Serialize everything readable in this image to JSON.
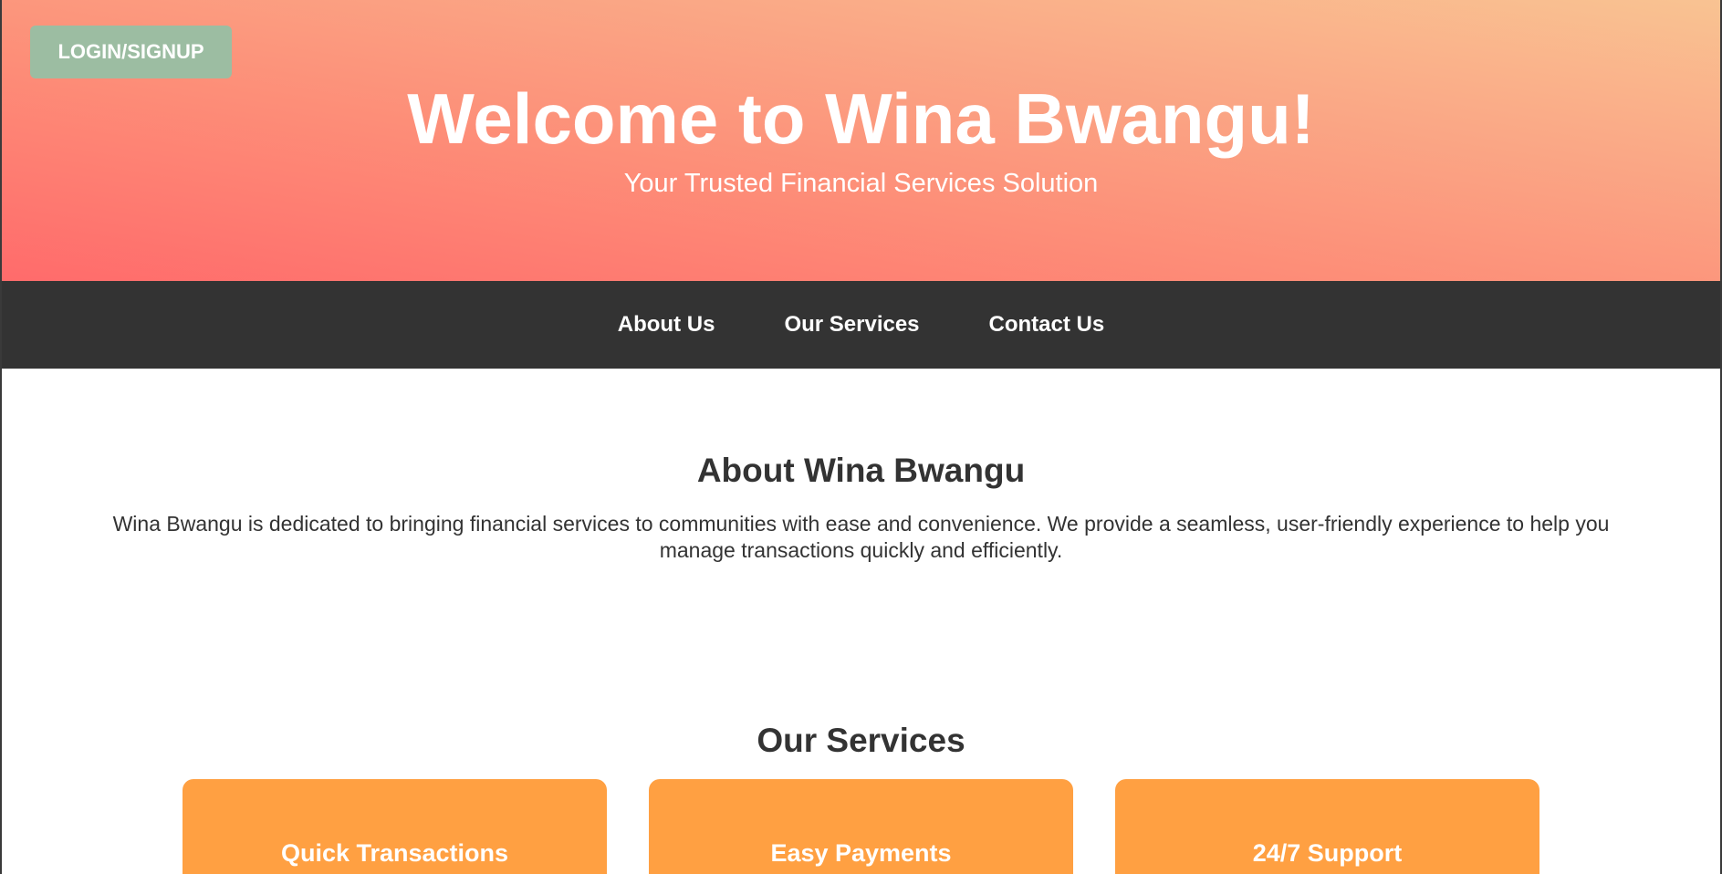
{
  "header": {
    "login_label": "LOGIN/SIGNUP",
    "title": "Welcome to Wina Bwangu!",
    "subtitle": "Your Trusted Financial Services Solution"
  },
  "nav": {
    "items": [
      {
        "label": "About Us"
      },
      {
        "label": "Our Services"
      },
      {
        "label": "Contact Us"
      }
    ]
  },
  "about": {
    "heading": "About Wina Bwangu",
    "text": "Wina Bwangu is dedicated to bringing financial services to communities with ease and convenience. We provide a seamless, user-friendly experience to help you manage transactions quickly and efficiently."
  },
  "services": {
    "heading": "Our Services",
    "cards": [
      {
        "title": "Quick Transactions"
      },
      {
        "title": "Easy Payments"
      },
      {
        "title": "24/7 Support"
      }
    ]
  },
  "colors": {
    "gradient_start": "#ff6b6b",
    "gradient_end": "#f9c392",
    "login_button": "#9cbda2",
    "navbar": "#333333",
    "card": "#ffa042",
    "text": "#333333"
  }
}
